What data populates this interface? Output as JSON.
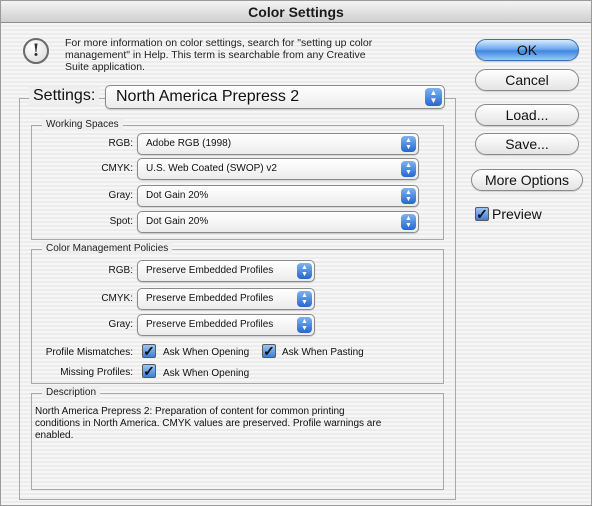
{
  "window": {
    "title": "Color Settings"
  },
  "info": {
    "icon": "exclamation-icon",
    "lines": [
      "For more information on color settings, search for \"setting up color",
      "management\" in Help. This term is searchable from any Creative",
      "Suite application."
    ]
  },
  "settings": {
    "label": "Settings:",
    "value": "North America Prepress 2"
  },
  "working_spaces": {
    "title": "Working Spaces",
    "rgb": {
      "label": "RGB:",
      "value": "Adobe RGB (1998)"
    },
    "cmyk": {
      "label": "CMYK:",
      "value": "U.S. Web Coated (SWOP) v2"
    },
    "gray": {
      "label": "Gray:",
      "value": "Dot Gain 20%"
    },
    "spot": {
      "label": "Spot:",
      "value": "Dot Gain 20%"
    }
  },
  "policies": {
    "title": "Color Management Policies",
    "rgb": {
      "label": "RGB:",
      "value": "Preserve Embedded Profiles"
    },
    "cmyk": {
      "label": "CMYK:",
      "value": "Preserve Embedded Profiles"
    },
    "gray": {
      "label": "Gray:",
      "value": "Preserve Embedded Profiles"
    },
    "profile_mismatches": {
      "label": "Profile Mismatches:",
      "ask_opening": {
        "label": "Ask When Opening",
        "checked": true
      },
      "ask_pasting": {
        "label": "Ask When Pasting",
        "checked": true
      }
    },
    "missing_profiles": {
      "label": "Missing Profiles:",
      "ask_opening": {
        "label": "Ask When Opening",
        "checked": true
      }
    }
  },
  "description": {
    "title": "Description",
    "lines": [
      "North America Prepress 2:  Preparation of content for common printing",
      "conditions in North America. CMYK values are preserved. Profile warnings are",
      "enabled."
    ]
  },
  "buttons": {
    "ok": "OK",
    "cancel": "Cancel",
    "load": "Load...",
    "save": "Save...",
    "more_options": "More Options"
  },
  "preview": {
    "label": "Preview",
    "checked": true
  },
  "colors": {
    "accent": "#3f86e2",
    "window_bg": "#efefef"
  }
}
